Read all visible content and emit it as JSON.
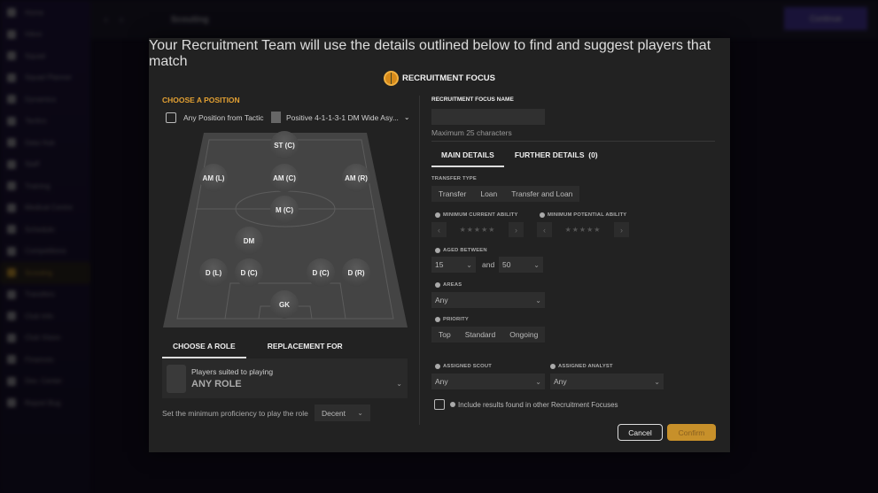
{
  "background": {
    "sidebar": [
      "Home",
      "Inbox",
      "Squad",
      "Squad Planner",
      "Dynamics",
      "Tactics",
      "Data Hub",
      "Staff",
      "Training",
      "Medical Centre",
      "Schedule",
      "Competitions",
      "Scouting",
      "Transfers",
      "Club Info",
      "Club Vision",
      "Finances",
      "Dev. Center",
      "Report Bug"
    ],
    "active_index": 12,
    "title": "Scouting",
    "continue": "Continue"
  },
  "modal": {
    "title": "RECRUITMENT FOCUS",
    "subtitle": "Your Recruitment Team will use the details outlined below to find and suggest players that match",
    "left": {
      "heading": "CHOOSE A POSITION",
      "any_position": "Any Position from Tactic",
      "tactic": "Positive 4-1-1-3-1 DM Wide Asy...",
      "positions": [
        "ST (C)",
        "AM (L)",
        "AM (C)",
        "AM (R)",
        "M (C)",
        "DM",
        "D (L)",
        "D (C)",
        "D (C)",
        "D (R)",
        "GK"
      ],
      "tabs": [
        "CHOOSE A ROLE",
        "REPLACEMENT FOR"
      ],
      "role_caption": "Players suited to playing",
      "role_value": "ANY ROLE",
      "proficiency_label": "Set the minimum proficiency to play the role",
      "proficiency_value": "Decent"
    },
    "right": {
      "name_label": "RECRUITMENT FOCUS NAME",
      "name_value": "",
      "name_hint": "Maximum 25 characters",
      "tabs": [
        "MAIN DETAILS",
        "FURTHER DETAILS  (0)"
      ],
      "transfer_type_label": "TRANSFER TYPE",
      "transfer_types": [
        "Transfer",
        "Loan",
        "Transfer and Loan"
      ],
      "min_ca_label": "MINIMUM CURRENT ABILITY",
      "min_pa_label": "MINIMUM POTENTIAL ABILITY",
      "min_ca_stars": 0,
      "min_pa_stars": 0,
      "aged_label": "AGED BETWEEN",
      "age_min": "15",
      "and": "and",
      "age_max": "50",
      "areas_label": "AREAS",
      "areas_value": "Any",
      "priority_label": "PRIORITY",
      "priorities": [
        "Top",
        "Standard",
        "Ongoing"
      ],
      "scout_label": "ASSIGNED SCOUT",
      "scout_value": "Any",
      "analyst_label": "ASSIGNED ANALYST",
      "analyst_value": "Any",
      "include_label": "Include results found in other Recruitment Focuses",
      "cancel": "Cancel",
      "confirm": "Confirm"
    }
  },
  "colors": {
    "accent": "#e2a033",
    "modal_bg": "#222222",
    "sidebar": "#1c1238"
  }
}
